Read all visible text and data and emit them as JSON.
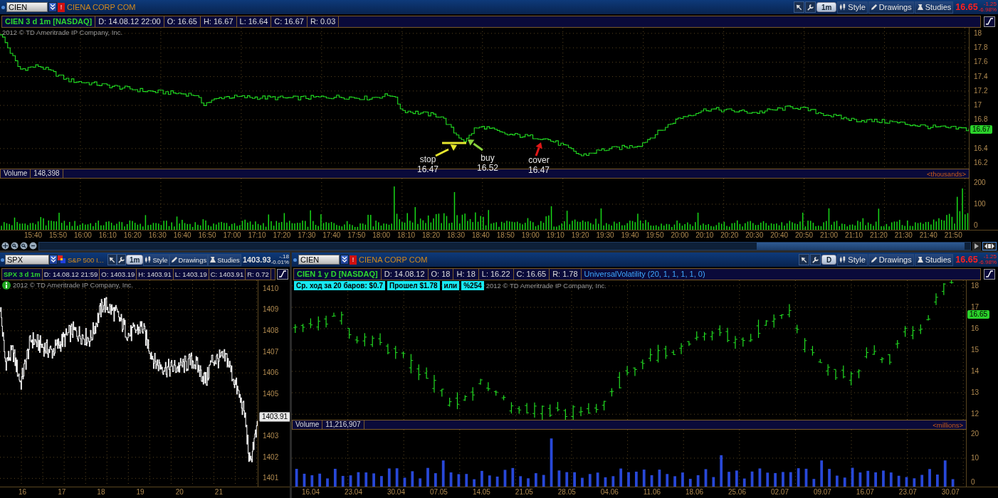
{
  "panels": [
    {
      "symbol": "CIEN",
      "badge": {
        "kind": "alert",
        "text": "!"
      },
      "company": "CIENA CORP COM",
      "aggregation": "1m",
      "buttons": [
        "Style",
        "Drawings",
        "Studies"
      ],
      "last": "16.65",
      "change": "-1.25",
      "change_pct": "-6.98%",
      "negative": true,
      "info_title": "CIEN 3 d 1m [NASDAQ]",
      "info_fields": [
        "D: 14.08.12 22:00",
        "O: 16.65",
        "H: 16.67",
        "L: 16.64",
        "C: 16.67",
        "R: 0.03"
      ],
      "copyright": {
        "text": "2012 © TD Ameritrade IP Company, Inc.",
        "info_icon": false
      },
      "kind": "step",
      "price_axis": [
        "18",
        "17.8",
        "17.6",
        "17.4",
        "17.2",
        "17",
        "16.8",
        "16.4",
        "16.2"
      ],
      "price_marker": "16.67",
      "annotations": [
        {
          "label": "stop",
          "price": "16.47",
          "color": "#e6e62e"
        },
        {
          "label": "buy",
          "price": "16.52",
          "color": "#8ad23c"
        },
        {
          "label": "cover",
          "price": "16.47",
          "color": "#e01818"
        }
      ],
      "volume": {
        "title": "Volume",
        "value": "148,398",
        "units": "<thousands>",
        "axis": [
          "200",
          "100",
          "0"
        ],
        "color": "#18d818"
      },
      "time_axis": [
        "15:40",
        "15:50",
        "16:00",
        "16:10",
        "16:20",
        "16:30",
        "16:40",
        "16:50",
        "17:00",
        "17:10",
        "17:20",
        "17:30",
        "17:40",
        "17:50",
        "18:00",
        "18:10",
        "18:20",
        "18:30",
        "18:40",
        "18:50",
        "19:00",
        "19:10",
        "19:20",
        "19:30",
        "19:40",
        "19:50",
        "20:00",
        "20:10",
        "20:20",
        "20:30",
        "20:40",
        "20:50",
        "21:00",
        "21:10",
        "21:20",
        "21:30",
        "21:40",
        "21:50"
      ],
      "scrollbar": true
    },
    {
      "symbol": "SPX",
      "badge": {
        "kind": "index"
      },
      "company": "S&P 500 I...",
      "aggregation": "1m",
      "buttons": [
        "Style",
        "Drawings",
        "Studies"
      ],
      "last": "1403.93",
      "change": "-.18",
      "change_pct": "-0.01%",
      "negative": false,
      "info_title": "SPX 3 d 1m",
      "info_fields": [
        "D: 14.08.12 21:59",
        "O: 1403.19",
        "H: 1403.91",
        "L: 1403.19",
        "C: 1403.91",
        "R: 0.72"
      ],
      "copyright": {
        "text": "2012 © TD Ameritrade IP Company, Inc.",
        "info_icon": true
      },
      "kind": "tick",
      "price_axis": [
        "1410",
        "1409",
        "1408",
        "1407",
        "1406",
        "1405",
        "1403",
        "1402",
        "1401"
      ],
      "price_marker": "1403.91",
      "time_axis": [
        "16",
        "17",
        "18",
        "19",
        "20",
        "21"
      ]
    },
    {
      "symbol": "CIEN",
      "badge": {
        "kind": "alert",
        "text": "!"
      },
      "company": "CIENA CORP COM",
      "aggregation": "D",
      "buttons": [
        "Style",
        "Drawings",
        "Studies"
      ],
      "last": "16.65",
      "change": "-1.25",
      "change_pct": "-6.98%",
      "negative": true,
      "info_title": "CIEN 1 y D [NASDAQ]",
      "info_fields": [
        "D: 14.08.12",
        "O: 18",
        "H: 18",
        "L: 16.22",
        "C: 16.65",
        "R: 1.78"
      ],
      "study": "UniversalVolatility (20, 1, 1, 1, 1, 0)",
      "study_badges": [
        "Ср. ход за 20 баров: $0.7",
        "Прошел $1.78",
        "или",
        "%254"
      ],
      "copyright": {
        "text": "2012 © TD Ameritrade IP Company, Inc.",
        "info_icon": false
      },
      "kind": "ohlc",
      "price_axis": [
        "18",
        "17",
        "16",
        "15",
        "14",
        "13",
        "12"
      ],
      "price_marker": "16.65",
      "volume": {
        "title": "Volume",
        "value": "11,216,907",
        "units": "<millions>",
        "axis": [
          "20",
          "10",
          "0"
        ],
        "color": "#2848d8"
      },
      "time_axis": [
        "16.04",
        "23.04",
        "30.04",
        "07.05",
        "14.05",
        "21.05",
        "28.05",
        "04.06",
        "11.06",
        "18.06",
        "25.06",
        "02.07",
        "09.07",
        "16.07",
        "23.07",
        "30.07"
      ]
    }
  ]
}
